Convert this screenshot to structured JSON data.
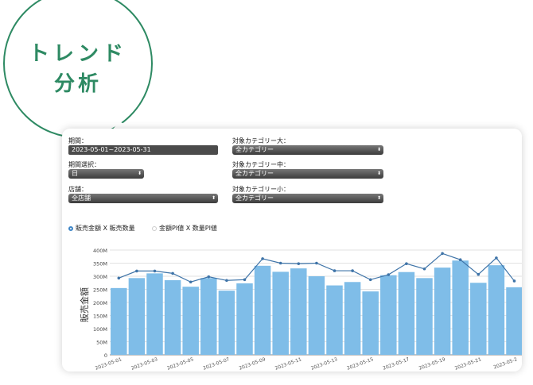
{
  "badge": {
    "line1": "トレンド",
    "line2": "分析"
  },
  "filters": {
    "period_label": "期間：",
    "period_value": "2023-05-01~2023-05-31",
    "period_select_label": "期間選択：",
    "period_select_value": "日",
    "store_label": "店舗：",
    "store_value": "全店舗",
    "cat_large_label": "対象カテゴリー大：",
    "cat_large_value": "全カテゴリー",
    "cat_mid_label": "対象カテゴリー中：",
    "cat_mid_value": "全カテゴリー",
    "cat_small_label": "対象カテゴリー小：",
    "cat_small_value": "全カテゴリー"
  },
  "radio": {
    "option1": "販売金額 X 販売数量",
    "option2": "金額PI値 X 数量PI値",
    "selected": 0
  },
  "chart_data": {
    "type": "bar",
    "ylabel": "販売金額",
    "yticks": [
      "0",
      "50M",
      "100M",
      "150M",
      "200M",
      "250M",
      "300M",
      "350M",
      "400M"
    ],
    "ylim": [
      0,
      400
    ],
    "xtick_labels": [
      "2023-05-01",
      "2023-05-03",
      "2023-05-05",
      "2023-05-07",
      "2023-05-09",
      "2023-05-11",
      "2023-05-13",
      "2023-05-15",
      "2023-05-17",
      "2023-05-19",
      "2023-05-21",
      "2023-05-2"
    ],
    "categories": [
      "2023-05-01",
      "2023-05-02",
      "2023-05-03",
      "2023-05-04",
      "2023-05-05",
      "2023-05-06",
      "2023-05-07",
      "2023-05-08",
      "2023-05-09",
      "2023-05-10",
      "2023-05-11",
      "2023-05-12",
      "2023-05-13",
      "2023-05-14",
      "2023-05-15",
      "2023-05-16",
      "2023-05-17",
      "2023-05-18",
      "2023-05-19",
      "2023-05-20",
      "2023-05-21",
      "2023-05-22",
      "2023-05-23"
    ],
    "series": [
      {
        "type": "bar",
        "values": [
          255,
          293,
          311,
          285,
          260,
          293,
          245,
          273,
          340,
          317,
          330,
          300,
          265,
          278,
          242,
          304,
          316,
          293,
          333,
          360,
          275,
          342,
          258
        ]
      },
      {
        "type": "line",
        "values": [
          293,
          320,
          320,
          311,
          278,
          298,
          284,
          287,
          367,
          350,
          348,
          350,
          321,
          321,
          287,
          306,
          348,
          328,
          387,
          363,
          307,
          370,
          282
        ]
      }
    ],
    "grid": true,
    "colors": {
      "bar": "#7fbde8",
      "line": "#3f74a8"
    }
  }
}
